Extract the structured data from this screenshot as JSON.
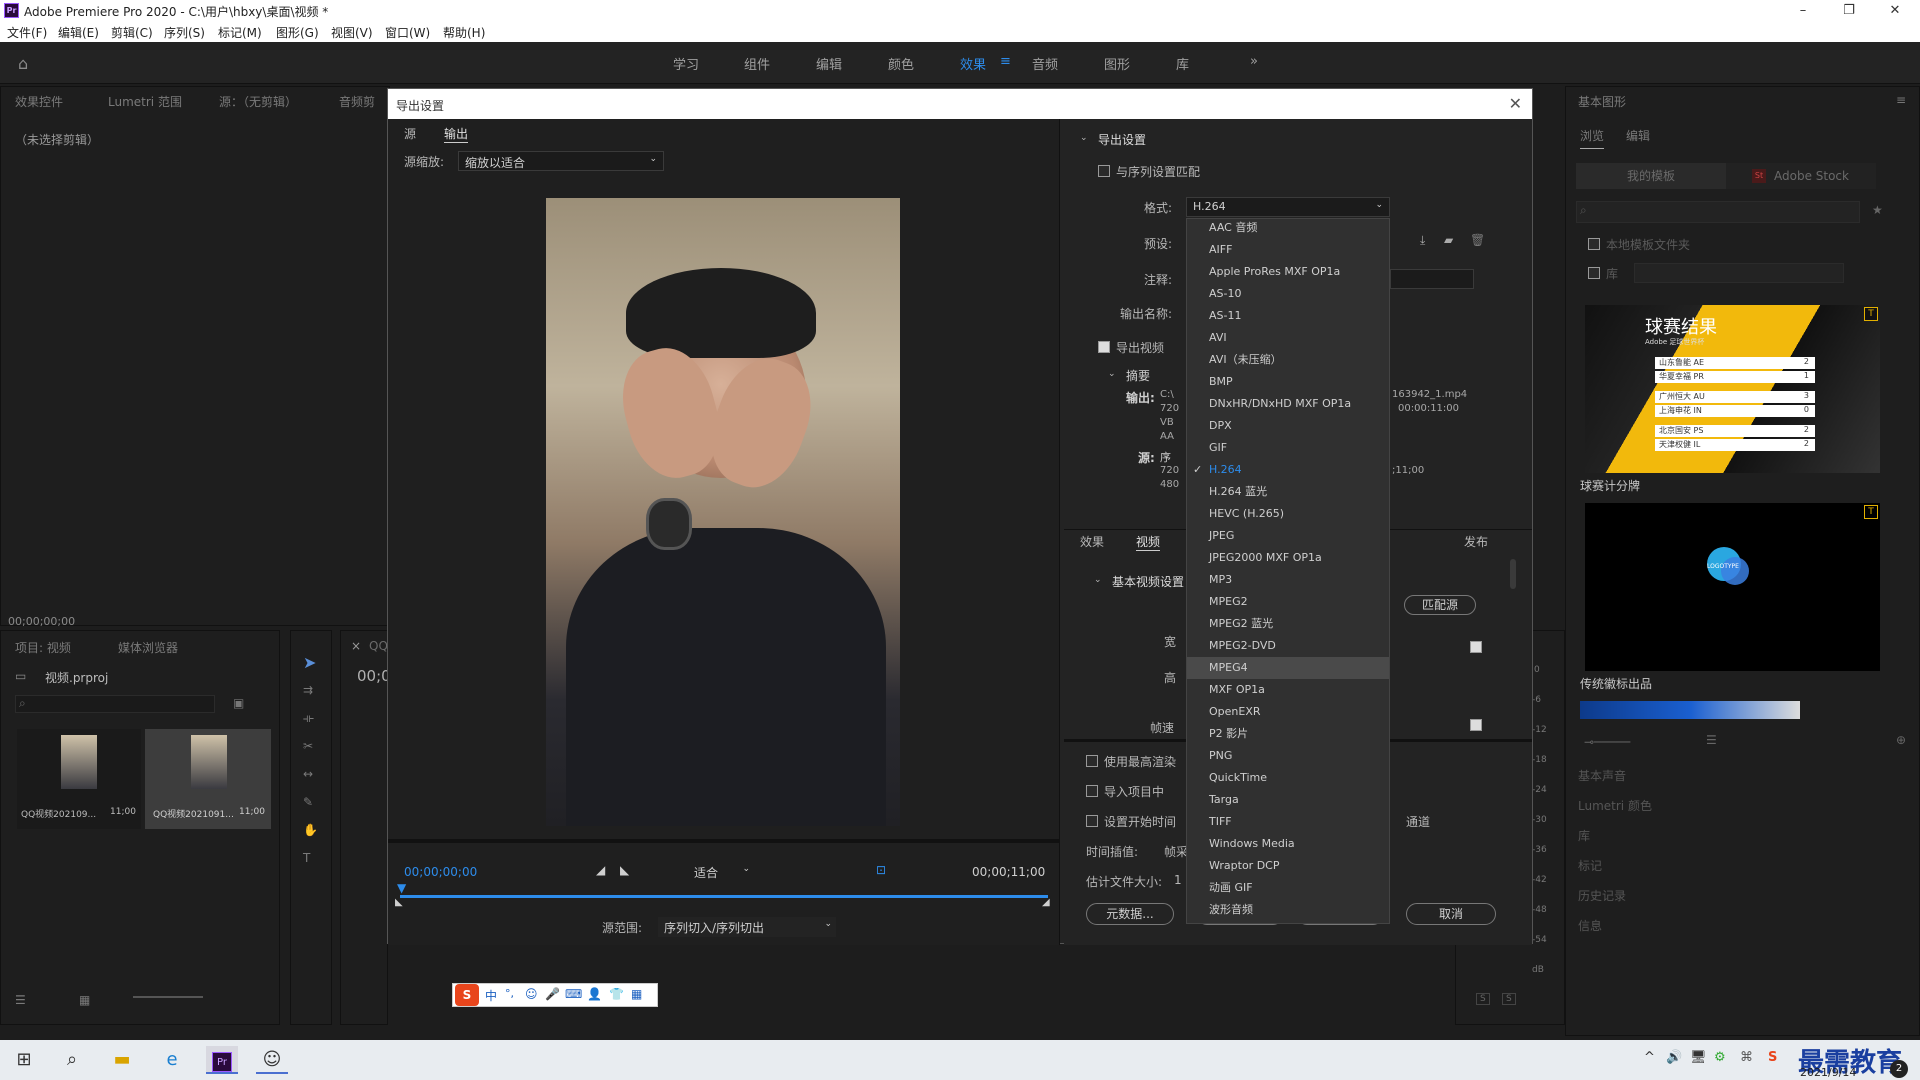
{
  "app": {
    "title": "Adobe Premiere Pro 2020 - C:\\用户\\hbxy\\桌面\\视频 *",
    "logo": "Pr",
    "window_controls": [
      "–",
      "❐",
      "✕"
    ]
  },
  "menu": [
    "文件(F)",
    "编辑(E)",
    "剪辑(C)",
    "序列(S)",
    "标记(M)",
    "图形(G)",
    "视图(V)",
    "窗口(W)",
    "帮助(H)"
  ],
  "workspaces": {
    "tabs": [
      "学习",
      "组件",
      "编辑",
      "颜色",
      "效果",
      "音频",
      "图形",
      "库"
    ],
    "active": "效果",
    "more": "»"
  },
  "left_top_panel": {
    "tabs": [
      "效果控件",
      "Lumetri 范围",
      "源：（无剪辑）",
      "音频剪"
    ],
    "empty_text": "（未选择剪辑）",
    "timecode": "00;00;00;00"
  },
  "project_panel": {
    "tabs": [
      "项目: 视频",
      "媒体浏览器"
    ],
    "project_name": "视频.prproj",
    "clips": [
      {
        "name": "QQ视频202109...",
        "duration": "11;00"
      },
      {
        "name": "QQ视频2021091...",
        "duration": "11;00"
      }
    ]
  },
  "timeline_stub": {
    "timecode": "00;0",
    "close": "×",
    "tab": "QQ"
  },
  "audio_meter_labels": [
    "0",
    "-6",
    "-12",
    "-18",
    "-24",
    "-30",
    "-36",
    "-42",
    "-48",
    "-54",
    "dB"
  ],
  "audio_meter_buttons": [
    "S",
    "S"
  ],
  "dialog": {
    "title": "导出设置",
    "close": "✕",
    "left": {
      "tabs": [
        "源",
        "输出"
      ],
      "active_tab": "输出",
      "source_scale_label": "源缩放:",
      "source_scale_value": "缩放以适合",
      "timecode_start": "00;00;00;00",
      "timecode_end": "00;00;11;00",
      "fit_value": "适合",
      "source_range_label": "源范围:",
      "source_range_value": "序列切入/序列切出"
    },
    "right": {
      "export_settings_header": "导出设置",
      "match_sequence_label": "与序列设置匹配",
      "format_label": "格式:",
      "format_value": "H.264",
      "preset_label": "预设:",
      "comment_label": "注释:",
      "output_name_label": "输出名称:",
      "export_video_label": "导出视频",
      "summary_header": "摘要",
      "output_label": "输出:",
      "output_lines_left": [
        "C:\\",
        "720",
        "VB",
        "AA"
      ],
      "output_lines_right": [
        "163942_1.mp4",
        "00:00:11:00"
      ],
      "source_label": "源:",
      "source_prefix": "序",
      "source_lines_left": [
        "720",
        "480"
      ],
      "source_lines_right": [
        ";11;00"
      ],
      "tabs": [
        "效果",
        "视频",
        "发布"
      ],
      "active_tab": "视频",
      "basic_video_header": "基本视频设置",
      "match_source_button": "匹配源",
      "partial_labels": [
        "宽",
        "高",
        "帧速"
      ],
      "use_max_render_label": "使用最高渲染",
      "import_project_label": "导入项目中",
      "set_start_time_label": "设置开始时间",
      "channel_fragment": "通道",
      "time_interp_label": "时间插值:",
      "time_interp_value": "帧采",
      "est_size_label": "估计文件大小:",
      "est_size_value": "1",
      "metadata_button": "元数据...",
      "cancel_button": "取消"
    },
    "format_options": [
      "AAC 音频",
      "AIFF",
      "Apple ProRes MXF OP1a",
      "AS-10",
      "AS-11",
      "AVI",
      "AVI（未压缩）",
      "BMP",
      "DNxHR/DNxHD MXF OP1a",
      "DPX",
      "GIF",
      "H.264",
      "H.264 蓝光",
      "HEVC (H.265)",
      "JPEG",
      "JPEG2000 MXF OP1a",
      "MP3",
      "MPEG2",
      "MPEG2 蓝光",
      "MPEG2-DVD",
      "MPEG4",
      "MXF OP1a",
      "OpenEXR",
      "P2 影片",
      "PNG",
      "QuickTime",
      "Targa",
      "TIFF",
      "Windows Media",
      "Wraptor DCP",
      "动画 GIF",
      "波形音频"
    ],
    "format_selected": "H.264",
    "format_hovered": "MPEG4",
    "check_mark": "✓"
  },
  "essential_graphics": {
    "title": "基本图形",
    "tabs": [
      "浏览",
      "编辑"
    ],
    "subtabs": [
      "我的模板",
      "Adobe Stock"
    ],
    "stock_badge": "St",
    "local_folder_label": "本地模板文件夹",
    "library_label": "库",
    "templates": [
      {
        "name": "球赛计分牌",
        "overlay_title": "球赛结果",
        "overlay_subtitle": "Adobe 足球世界杯",
        "rows": [
          [
            "山东鲁能 AE",
            "2"
          ],
          [
            "华夏幸福 PR",
            "1"
          ],
          [
            "广州恒大 AU",
            "3"
          ],
          [
            "上海申花 IN",
            "0"
          ],
          [
            "北京国安 PS",
            "2"
          ],
          [
            "天津权健 IL",
            "2"
          ]
        ]
      },
      {
        "name": "传统徽标出品",
        "overlay_title": "LOGOTYPE"
      }
    ]
  },
  "right_collapsed_panels": [
    "基本声音",
    "Lumetri 颜色",
    "库",
    "标记",
    "历史记录",
    "信息"
  ],
  "ime_toolbar": {
    "logo": "S",
    "items": [
      "中",
      "°,",
      "☺",
      "🎤",
      "⌨",
      "👤",
      "👕",
      "▦"
    ]
  },
  "taskbar": {
    "tray_icons": [
      "^",
      "🔊",
      "🖥",
      "⚙",
      "⌘",
      "S"
    ],
    "date": "2021/9/14",
    "watermark": "最需教育",
    "notification_count": "2"
  },
  "colors": {
    "accent_blue": "#2d8ceb",
    "panel_bg": "#1e1e1e",
    "dialog_bg": "#232323",
    "dropdown_bg": "#303030",
    "dropdown_hover": "#4a4a4a"
  }
}
